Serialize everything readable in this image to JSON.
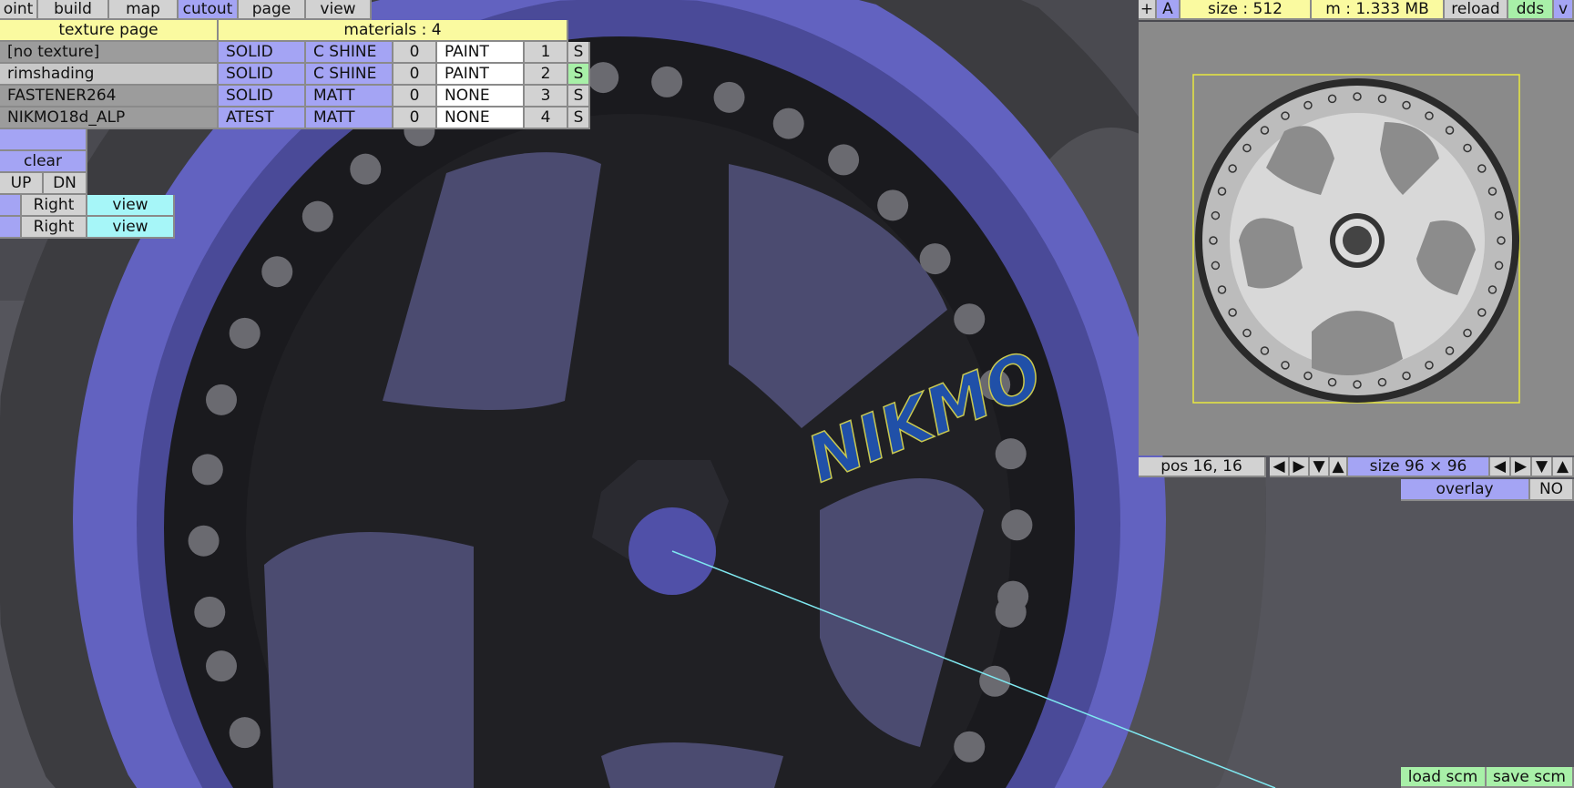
{
  "menu": {
    "tabs": [
      "oint",
      "build",
      "map",
      "cutout",
      "page",
      "view"
    ],
    "active": "cutout"
  },
  "materials": {
    "texture_header": "texture page",
    "materials_header": "materials : 4",
    "rows": [
      {
        "name": "[no texture]",
        "mode": "SOLID",
        "shine": "C SHINE",
        "val": "0",
        "type": "PAINT",
        "num": "1",
        "s": "S"
      },
      {
        "name": "rimshading",
        "mode": "SOLID",
        "shine": "C SHINE",
        "val": "0",
        "type": "PAINT",
        "num": "2",
        "s": "S"
      },
      {
        "name": "FASTENER264",
        "mode": "SOLID",
        "shine": "MATT",
        "val": "0",
        "type": "NONE",
        "num": "3",
        "s": "S"
      },
      {
        "name": "NIKMO18d_ALP",
        "mode": "ATEST",
        "shine": "MATT",
        "val": "0",
        "type": "NONE",
        "num": "4",
        "s": "S"
      }
    ]
  },
  "left_panel": {
    "clear": "clear",
    "up": "UP",
    "dn": "DN",
    "rows": [
      {
        "label": "Right",
        "view": "view"
      },
      {
        "label": "Right",
        "view": "view"
      }
    ]
  },
  "texture_panel": {
    "plus": "+",
    "a": "A",
    "size": "size : 512",
    "mem": "m : 1.333 MB",
    "reload": "reload",
    "dds": "dds",
    "v": "v",
    "pos": "pos 16, 16",
    "tile_size": "size 96 × 96",
    "arrows": [
      "◀",
      "▶",
      "▼",
      "▲"
    ],
    "overlay": "overlay",
    "overlay_value": "NO"
  },
  "bottom": {
    "load": "load scm",
    "save": "save scm"
  },
  "scene": {
    "logo": "NIKMO"
  },
  "colors": {
    "rim": "#5c5cb0",
    "accent": "#a4a4f4"
  }
}
